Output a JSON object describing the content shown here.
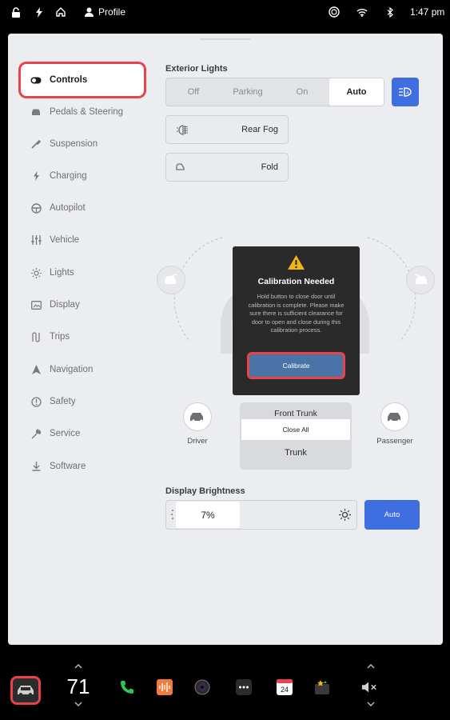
{
  "status_bar": {
    "profile_label": "Profile",
    "time": "1:47 pm"
  },
  "sidebar": {
    "items": [
      {
        "label": "Controls",
        "icon": "toggle-icon",
        "active": true
      },
      {
        "label": "Pedals & Steering",
        "icon": "car-icon"
      },
      {
        "label": "Suspension",
        "icon": "wrench-icon"
      },
      {
        "label": "Charging",
        "icon": "bolt-icon"
      },
      {
        "label": "Autopilot",
        "icon": "steering-wheel-icon"
      },
      {
        "label": "Vehicle",
        "icon": "sliders-icon"
      },
      {
        "label": "Lights",
        "icon": "sun-icon"
      },
      {
        "label": "Display",
        "icon": "display-icon"
      },
      {
        "label": "Trips",
        "icon": "trips-icon"
      },
      {
        "label": "Navigation",
        "icon": "navigation-icon"
      },
      {
        "label": "Safety",
        "icon": "alert-circle-icon"
      },
      {
        "label": "Service",
        "icon": "wrench-icon"
      },
      {
        "label": "Software",
        "icon": "download-icon"
      }
    ]
  },
  "exterior_lights": {
    "title": "Exterior Lights",
    "options": [
      "Off",
      "Parking",
      "On",
      "Auto"
    ],
    "selected": "Auto",
    "rear_fog_label": "Rear Fog",
    "fold_label": "Fold"
  },
  "car_controls": {
    "driver_label": "Driver",
    "passenger_label": "Passenger",
    "front_trunk_label": "Front Trunk",
    "close_all_label": "Close All",
    "trunk_label": "Trunk"
  },
  "dialog": {
    "title": "Calibration Needed",
    "body": "Hold button to close door until calibration is complete. Please make sure there is sufficient clearance for door to open and close during this calibration process.",
    "button_label": "Calibrate"
  },
  "brightness": {
    "title": "Display Brightness",
    "value_label": "7%",
    "value": 7,
    "auto_label": "Auto"
  },
  "dock": {
    "temperature": "71",
    "calendar_day": "24"
  },
  "colors": {
    "accent_blue": "#3e6ee0",
    "highlight_red": "#e8424a",
    "dialog_bg": "#2a2a2b"
  }
}
